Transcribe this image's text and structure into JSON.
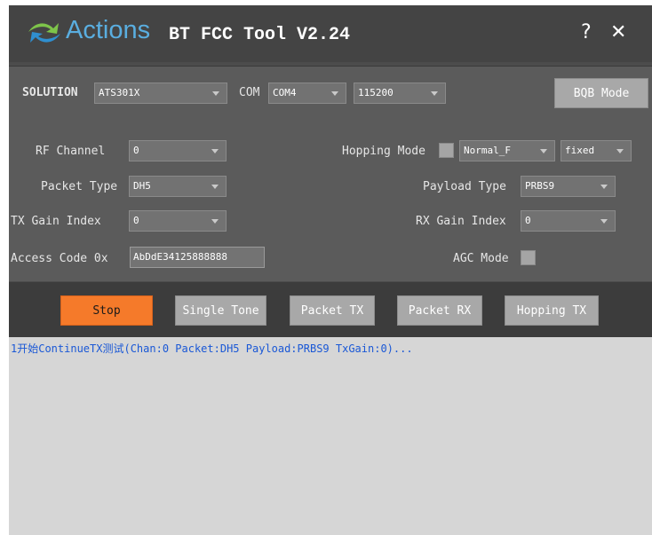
{
  "title": {
    "brand": "Actions",
    "app": "BT FCC Tool V2.24",
    "help_glyph": "?",
    "close_glyph": "✕"
  },
  "config": {
    "solution_label": "SOLUTION",
    "solution_value": "ATS301X",
    "com_label": "COM",
    "com_value": "COM4",
    "baud_value": "115200",
    "bqb_button": "BQB Mode"
  },
  "params": {
    "rf_channel_label": "RF Channel",
    "rf_channel_value": "0",
    "hopping_mode_label": "Hopping Mode",
    "hopping_type_value": "Normal_F",
    "hopping_fixed_value": "fixed",
    "packet_type_label": "Packet Type",
    "packet_type_value": "DH5",
    "payload_type_label": "Payload Type",
    "payload_type_value": "PRBS9",
    "tx_gain_label": "TX Gain Index",
    "tx_gain_value": "0",
    "rx_gain_label": "RX Gain Index",
    "rx_gain_value": "0",
    "access_code_label": "Access Code 0x",
    "access_code_value": "AbDdE34125888888",
    "agc_mode_label": "AGC Mode"
  },
  "actions": {
    "stop": "Stop",
    "single_tone": "Single Tone",
    "packet_tx": "Packet TX",
    "packet_rx": "Packet RX",
    "hopping_tx": "Hopping TX"
  },
  "log": {
    "line1": "1开始ContinueTX测试(Chan:0 Packet:DH5 Payload:PRBS9 TxGain:0)..."
  },
  "colors": {
    "stop_button": "#f57a2a",
    "brand": "#5aaee0",
    "log_text": "#1a58d6"
  }
}
